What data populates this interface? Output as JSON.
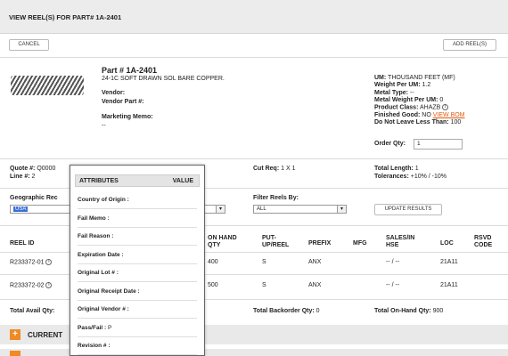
{
  "header": {
    "title": "VIEW REEL(S) FOR PART# 1A-2401"
  },
  "toolbar": {
    "cancel_label": "CANCEL",
    "add_reels_label": "ADD REEL(S)"
  },
  "part": {
    "title": "Part # 1A-2401",
    "description": "24-1C SOFT DRAWN SOL BARE COPPER.",
    "vendor_label": "Vendor:",
    "vendor_part_label": "Vendor Part #:",
    "marketing_memo_label": "Marketing Memo:",
    "marketing_memo_value": "--"
  },
  "specs": {
    "um_label": "UM:",
    "um_value": "THOUSAND FEET (MF)",
    "weight_label": "Weight Per UM:",
    "weight_value": "1.2",
    "metal_type_label": "Metal Type:",
    "metal_type_value": "--",
    "metal_weight_label": "Metal Weight Per UM:",
    "metal_weight_value": "0",
    "product_class_label": "Product Class:",
    "product_class_value": "AHAZB",
    "finished_good_label": "Finished Good:",
    "finished_good_value": "NO",
    "view_bom": "VIEW BOM",
    "dnl_label": "Do Not Leave Less Than:",
    "dnl_value": "100",
    "order_qty_label": "Order Qty:",
    "order_qty_value": "1"
  },
  "quote": {
    "quote_label": "Quote #:",
    "quote_value": "Q0000",
    "line_label": "Line #:",
    "line_value": "2",
    "cut_req_label": "Cut Req:",
    "cut_req_value": "1 X 1",
    "total_length_label": "Total Length:",
    "total_length_value": "1",
    "tolerances_label": "Tolerances:",
    "tolerances_value": "+10% / -10%"
  },
  "filters": {
    "geo_label": "Geographic Rec",
    "geo_value": "USA",
    "filter_label": "Filter Reels By:",
    "filter_value": "ALL",
    "update_label": "UPDATE RESULTS"
  },
  "table": {
    "headers": {
      "reel_id": "REEL ID",
      "on_hand": [
        "ON HAND",
        "QTY"
      ],
      "put_up": [
        "PUT-",
        "UP/REEL"
      ],
      "prefix": "PREFIX",
      "mfg": "MFG",
      "sales": [
        "SALES/IN",
        "HSE"
      ],
      "loc": "LOC",
      "rsvd": [
        "RSVD",
        "CODE"
      ]
    },
    "rows": [
      {
        "reel_id": "R233372-01",
        "on_hand": "400",
        "put_up": "S",
        "prefix": "ANX",
        "sales": "-- / --",
        "loc": "21A11"
      },
      {
        "reel_id": "R233372-02",
        "on_hand": "500",
        "put_up": "S",
        "prefix": "ANX",
        "sales": "-- / --",
        "loc": "21A11"
      }
    ]
  },
  "totals": {
    "avail_label": "Total Avail Qty:",
    "backorder_label": "Total Backorder Qty:",
    "backorder_value": "0",
    "onhand_label": "Total On-Hand Qty:",
    "onhand_value": "900"
  },
  "section": {
    "current_label": "CURRENT"
  },
  "popup": {
    "col_attr": "ATTRIBUTES",
    "col_value": "VALUE",
    "rows": [
      {
        "label": "Country of Origin",
        "value": ""
      },
      {
        "label": "Fail Memo",
        "value": ""
      },
      {
        "label": "Fail Reason",
        "value": ""
      },
      {
        "label": "Expiration Date",
        "value": ""
      },
      {
        "label": "Original Lot #",
        "value": ""
      },
      {
        "label": "Original Receipt Date",
        "value": ""
      },
      {
        "label": "Original Vendor #",
        "value": ""
      },
      {
        "label": "Pass/Fail",
        "value": "P"
      },
      {
        "label": "Revision #",
        "value": ""
      }
    ]
  },
  "colors": {
    "accent": "#f08a24",
    "link": "#e05a10",
    "header_bg": "#ececec"
  }
}
